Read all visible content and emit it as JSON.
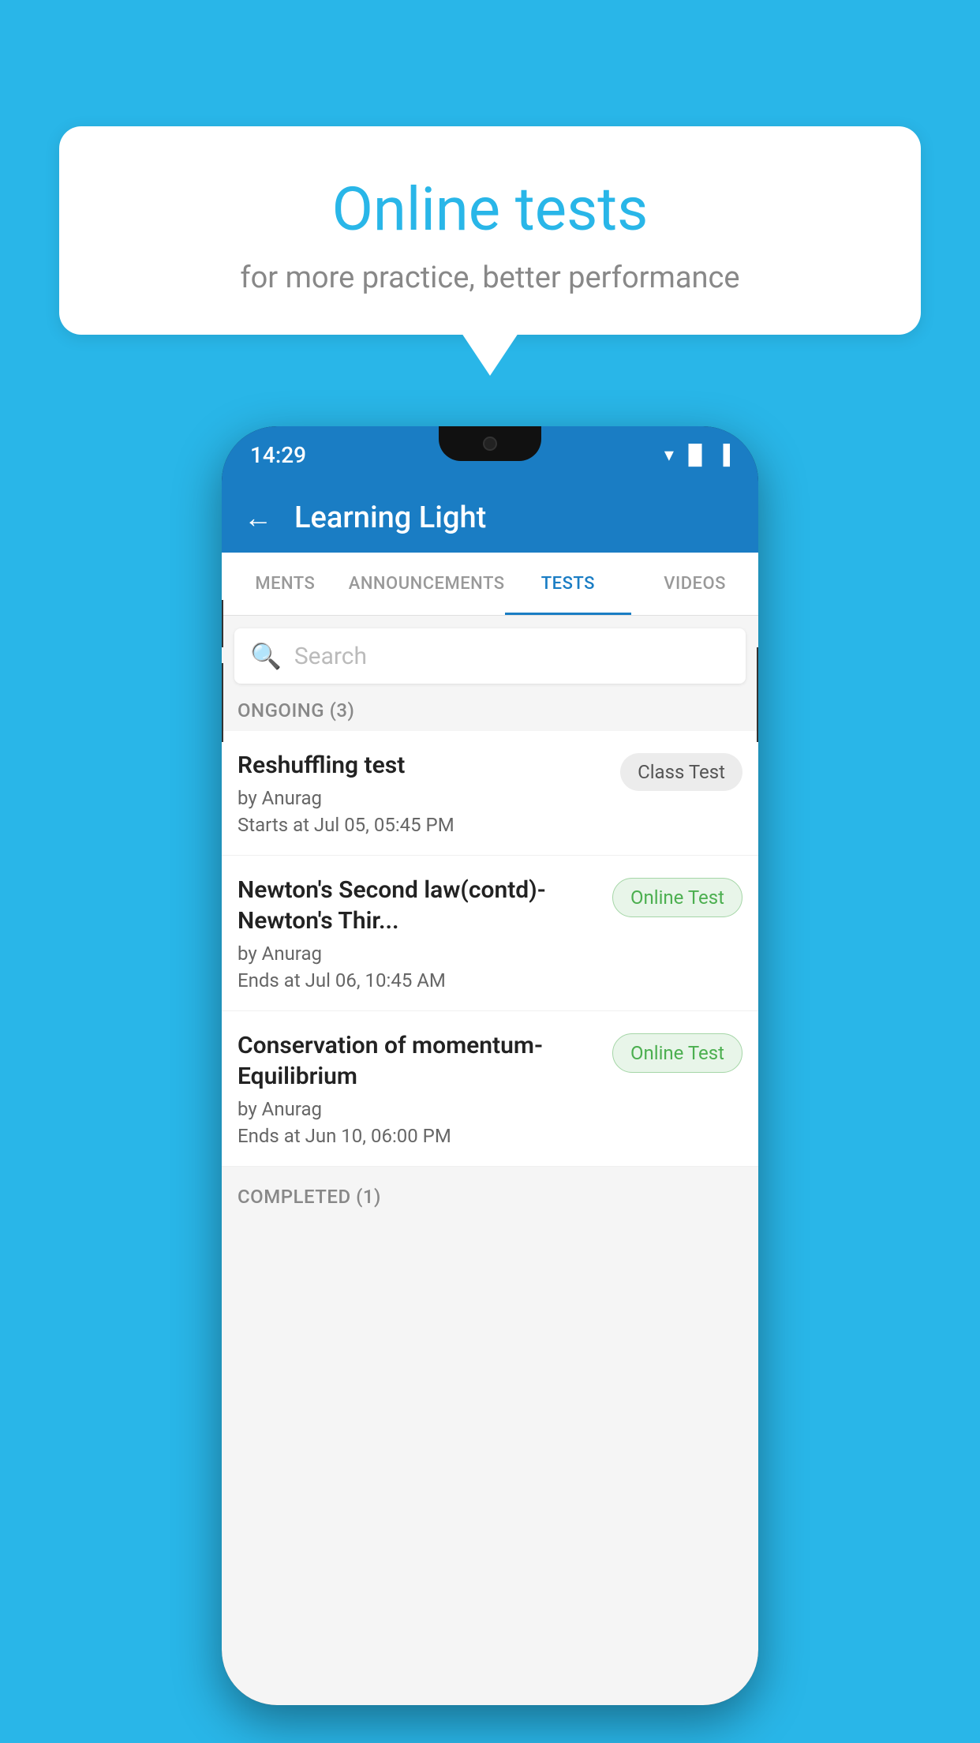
{
  "background": {
    "color": "#29b6e8"
  },
  "speech_bubble": {
    "title": "Online tests",
    "subtitle": "for more practice, better performance"
  },
  "phone": {
    "status_bar": {
      "time": "14:29",
      "icons": [
        "▼",
        "◂▸",
        "▐"
      ]
    },
    "header": {
      "back_label": "←",
      "title": "Learning Light"
    },
    "tabs": [
      {
        "label": "MENTS",
        "active": false
      },
      {
        "label": "ANNOUNCEMENTS",
        "active": false
      },
      {
        "label": "TESTS",
        "active": true
      },
      {
        "label": "VIDEOS",
        "active": false
      }
    ],
    "search": {
      "placeholder": "Search"
    },
    "ongoing_section": {
      "header": "ONGOING (3)",
      "tests": [
        {
          "title": "Reshuffling test",
          "author": "by Anurag",
          "date": "Starts at  Jul 05, 05:45 PM",
          "badge": "Class Test",
          "badge_type": "class"
        },
        {
          "title": "Newton's Second law(contd)-Newton's Thir...",
          "author": "by Anurag",
          "date": "Ends at  Jul 06, 10:45 AM",
          "badge": "Online Test",
          "badge_type": "online"
        },
        {
          "title": "Conservation of momentum-Equilibrium",
          "author": "by Anurag",
          "date": "Ends at  Jun 10, 06:00 PM",
          "badge": "Online Test",
          "badge_type": "online"
        }
      ]
    },
    "completed_section": {
      "header": "COMPLETED (1)"
    }
  }
}
